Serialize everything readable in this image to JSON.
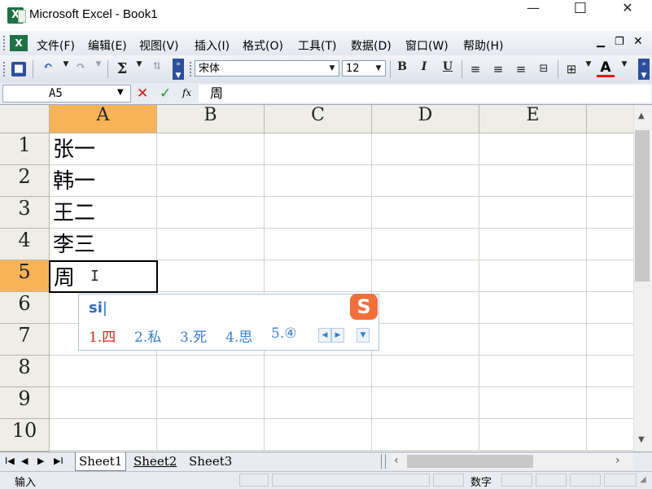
{
  "window": {
    "title": "Microsoft Excel - Book1",
    "minimize": "—",
    "maximize": "☐",
    "close": "✕"
  },
  "menu": [
    "文件(F)",
    "编辑(E)",
    "视图(V)",
    "插入(I)",
    "格式(O)",
    "工具(T)",
    "数据(D)",
    "窗口(W)",
    "帮助(H)"
  ],
  "toolbar": {
    "font": "宋体",
    "size": "12",
    "sum": "Σ",
    "bold": "B",
    "italic": "I",
    "underline": "U",
    "font_color": "A"
  },
  "formula_bar": {
    "name_box": "A5",
    "cancel": "✕",
    "enter": "✓",
    "fx": "fx",
    "value": "周"
  },
  "columns": [
    "A",
    "B",
    "C",
    "D",
    "E"
  ],
  "rows": [
    "1",
    "2",
    "3",
    "4",
    "5",
    "6",
    "7",
    "8",
    "9",
    "10"
  ],
  "cells": {
    "A1": "张一",
    "A2": "韩一",
    "A3": "王二",
    "A4": "李三",
    "A5": "周"
  },
  "ime": {
    "input": "si",
    "candidates": [
      "1.四",
      "2.私",
      "3.死",
      "4.思",
      "5.④"
    ],
    "logo": "S"
  },
  "sheet_tabs": [
    "Sheet1",
    "Sheet2",
    "Sheet3"
  ],
  "status": {
    "mode": "输入",
    "numlock": "数字"
  }
}
